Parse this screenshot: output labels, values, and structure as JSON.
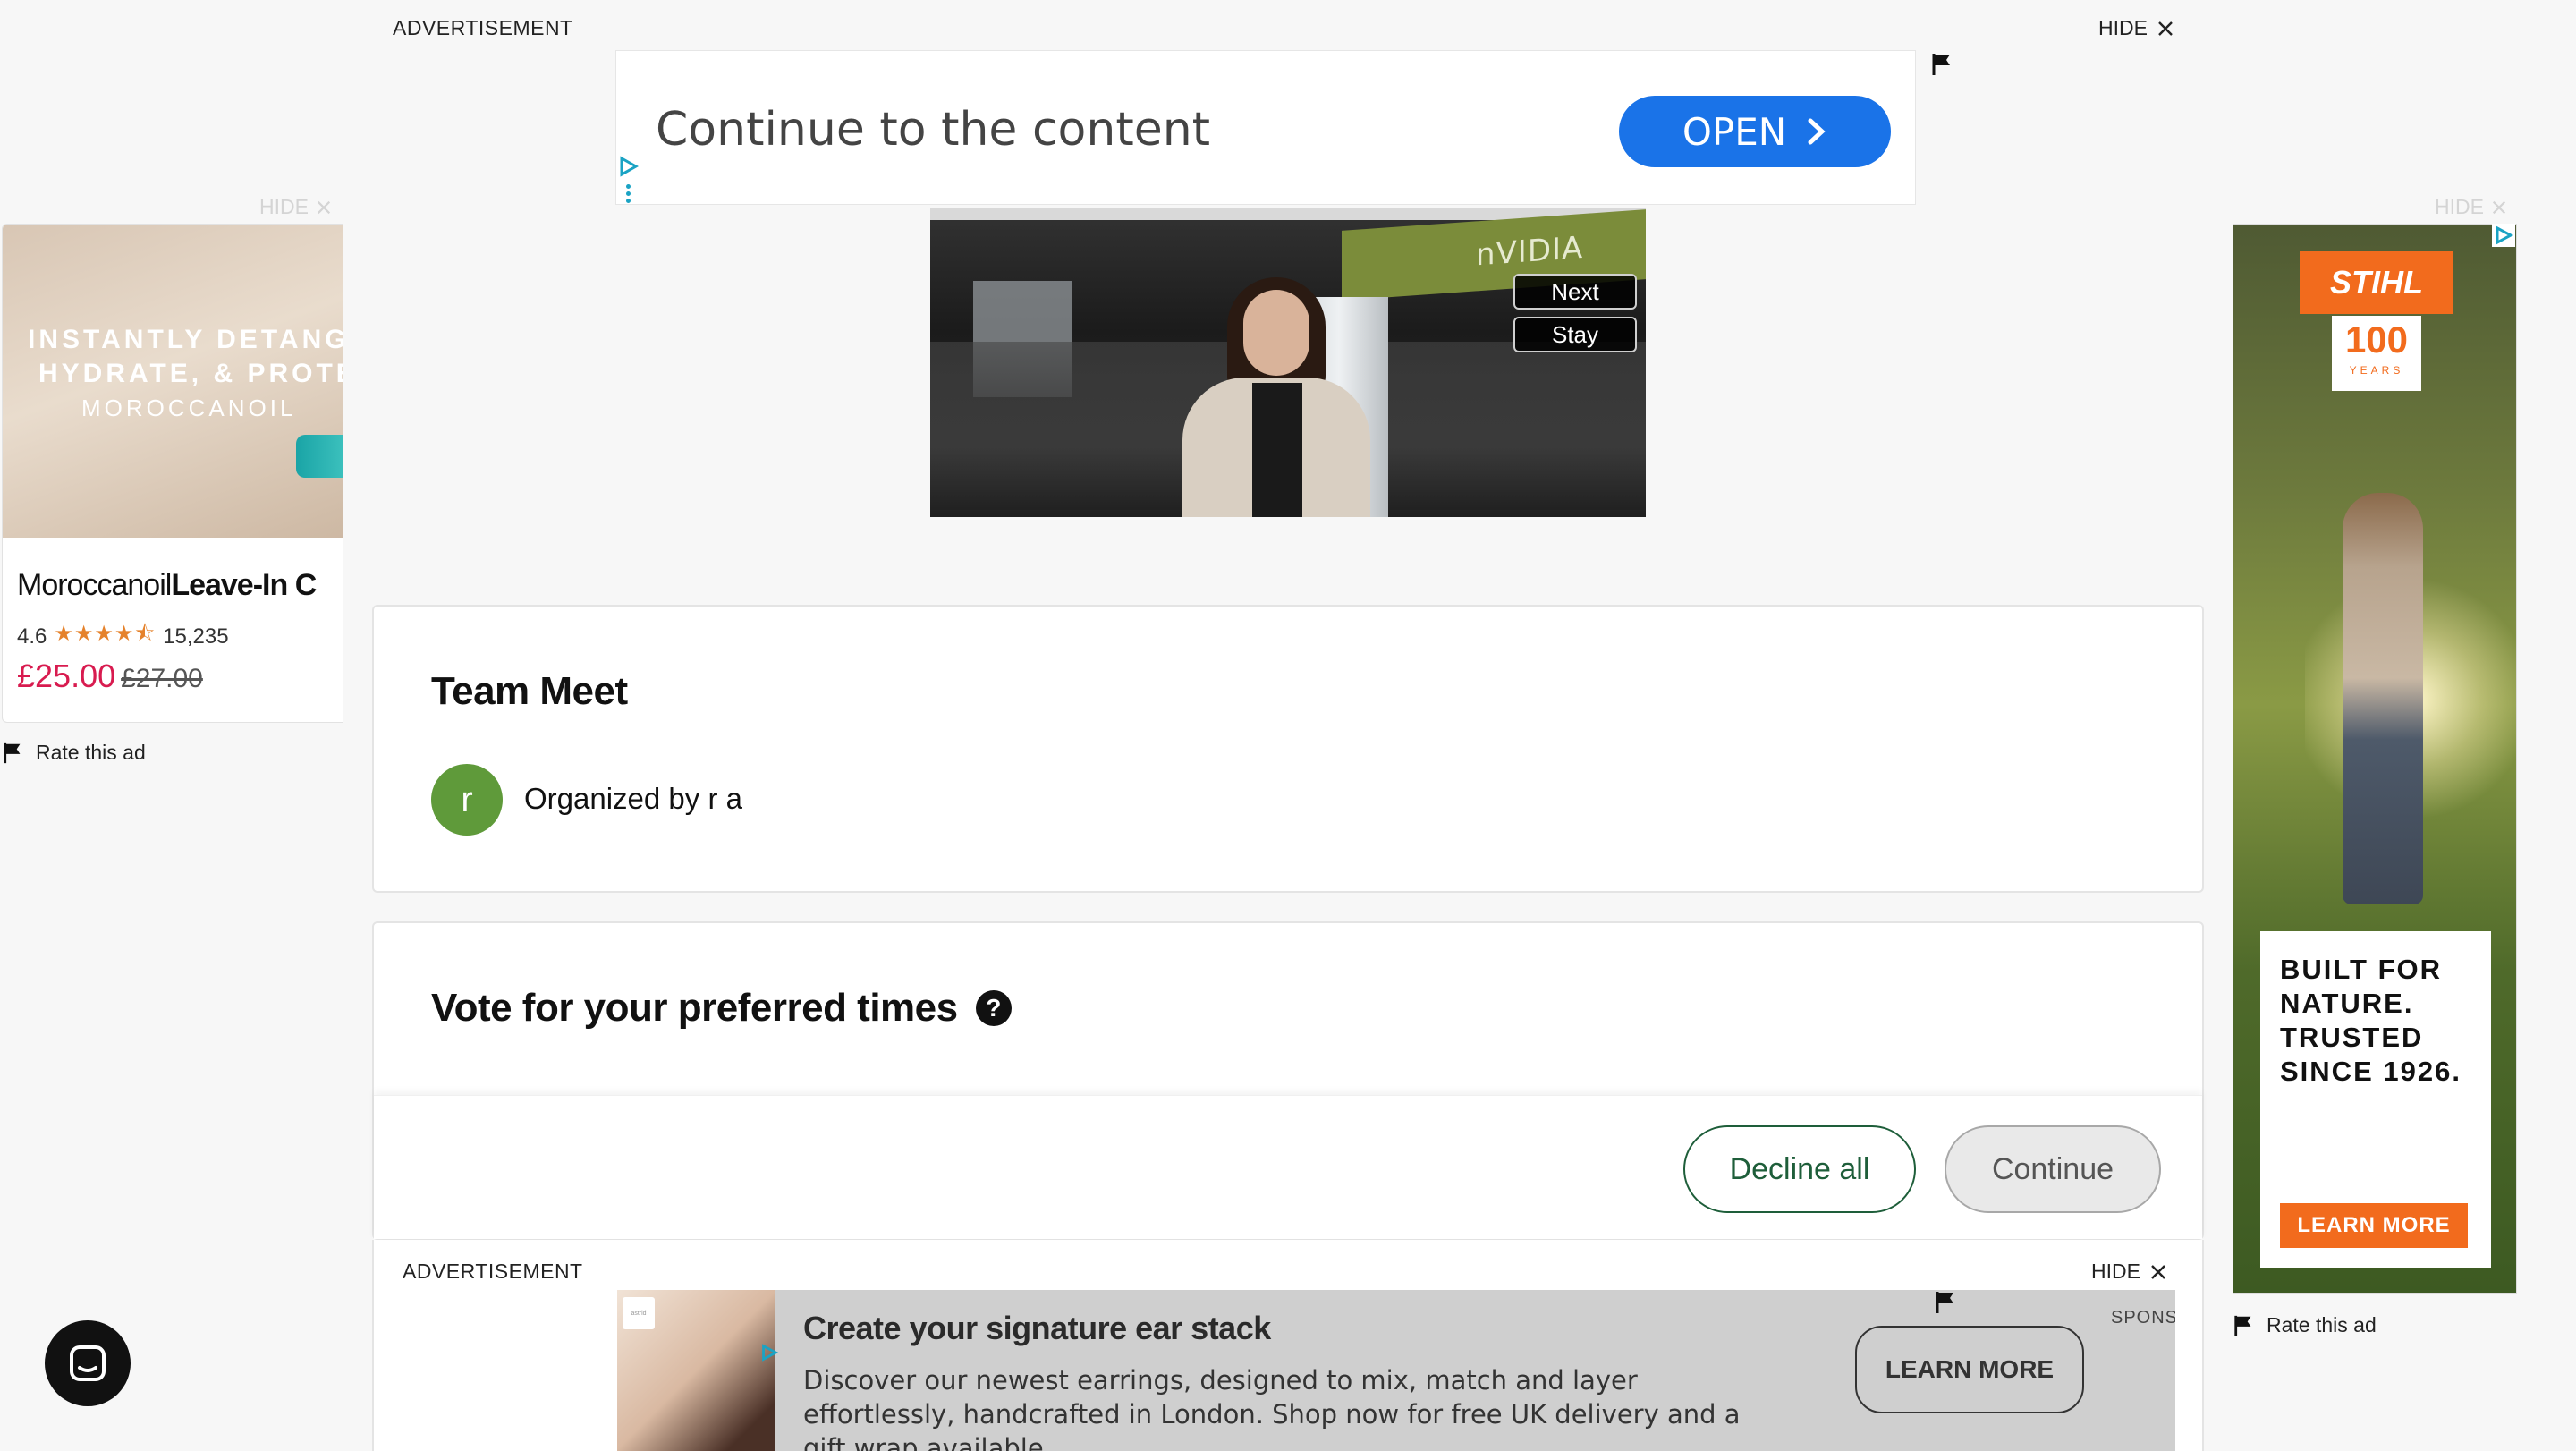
{
  "top_ad": {
    "label": "ADVERTISEMENT",
    "hide": "HIDE",
    "headline": "Continue to the content",
    "open_button": "OPEN"
  },
  "video": {
    "sign_text": "nVIDIA",
    "next_button": "Next",
    "stay_button": "Stay"
  },
  "left_ad": {
    "hide": "HIDE",
    "tagline_1": "INSTANTLY DETANGLE",
    "tagline_2": "HYDRATE, & PROTECT",
    "brand": "MOROCCANOIL",
    "title_regular": "Moroccanoil",
    "title_bold": "Leave-In C",
    "rating": "4.6",
    "stars": "★★★★⯪",
    "review_count": "15,235",
    "price": "£25.00",
    "old_price": "£27.00",
    "rate_label": "Rate this ad"
  },
  "right_ad": {
    "hide": "HIDE",
    "brand": "STIHL",
    "years_number": "100",
    "years_label": "YEARS",
    "panel_text": "BUILT FOR NATURE. TRUSTED SINCE 1926.",
    "learn_more": "LEARN MORE",
    "rate_label": "Rate this ad"
  },
  "event": {
    "title": "Team Meet",
    "avatar_initial": "r",
    "organizer": "Organized by r a"
  },
  "vote": {
    "title": "Vote for your preferred times",
    "help_symbol": "?",
    "decline_button": "Decline all",
    "continue_button": "Continue"
  },
  "bottom_ad": {
    "label": "ADVERTISEMENT",
    "hide": "HIDE",
    "headline": "Create your signature ear stack",
    "body": "Discover our newest earrings, designed to mix, match and layer effortlessly, handcrafted in London. Shop now for free UK delivery and a gift wrap available.",
    "learn_more": "LEARN MORE",
    "sponsored": "SPONS",
    "logo_text": "astrid"
  },
  "icons": {
    "close": "close-icon",
    "flag": "flag-icon",
    "chevron": "chevron-right-icon",
    "adchoices": "adchoices-icon",
    "chat": "chat-icon"
  },
  "colors": {
    "primary_green": "#1e5e3a",
    "avatar_green": "#5f9a3a",
    "open_blue": "#1a73e8",
    "stihl_orange": "#f26b1d",
    "price_red": "#d81b4f"
  }
}
